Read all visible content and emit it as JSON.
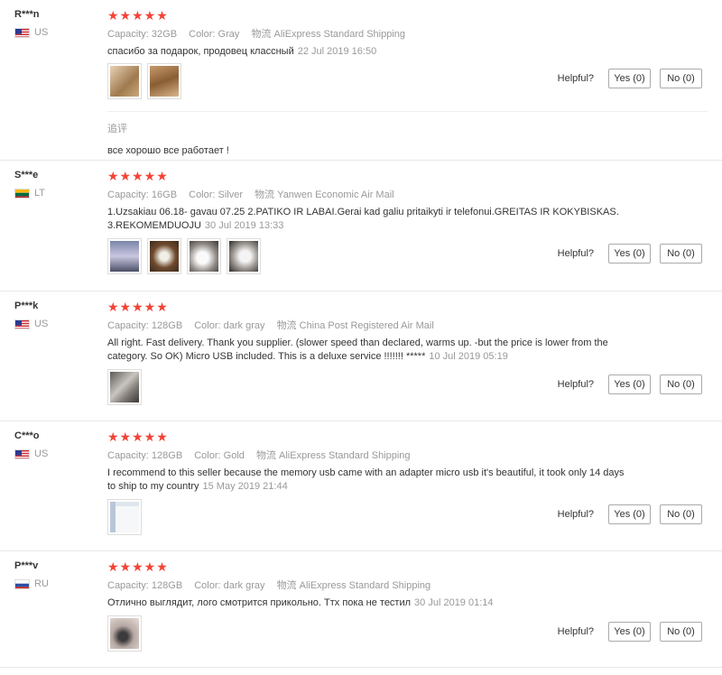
{
  "reviews": [
    {
      "user": "R***n",
      "country": "US",
      "stars": "★★★★★",
      "capacity_label": "Capacity:",
      "capacity": "32GB",
      "color_label": "Color:",
      "color": "Gray",
      "ship_label": "物流",
      "shipping": "AliExpress Standard Shipping",
      "text": "спасибо за подарок, продовец классный",
      "date": "22 Jul 2019 16:50",
      "helpful": "Helpful?",
      "yes": "Yes (0)",
      "no": "No (0)",
      "additional_label": "追评",
      "additional_text": "все хорошо все работает !"
    },
    {
      "user": "S***e",
      "country": "LT",
      "stars": "★★★★★",
      "capacity_label": "Capacity:",
      "capacity": "16GB",
      "color_label": "Color:",
      "color": "Silver",
      "ship_label": "物流",
      "shipping": "Yanwen Economic Air Mail",
      "text_line1": "1.Uzsakiau 06.18- gavau 07.25 2.PATIKO IR LABAI.Gerai kad galiu pritaikyti ir telefonui.GREITAS IR KOKYBISKAS.",
      "text_line2": "3.REKOMEMDUOJU",
      "date": "30 Jul 2019 13:33",
      "helpful": "Helpful?",
      "yes": "Yes (0)",
      "no": "No (0)"
    },
    {
      "user": "P***k",
      "country": "US",
      "stars": "★★★★★",
      "capacity_label": "Capacity:",
      "capacity": "128GB",
      "color_label": "Color:",
      "color": "dark gray",
      "ship_label": "物流",
      "shipping": "China Post Registered Air Mail",
      "text_line1": "All right. Fast delivery. Thank you supplier. (slower speed than declared, warms up. -but the price is lower from the",
      "text_line2": "category. So OK) Micro USB included. This is a deluxe service !!!!!!! *****",
      "date": "10 Jul 2019 05:19",
      "helpful": "Helpful?",
      "yes": "Yes (0)",
      "no": "No (0)"
    },
    {
      "user": "C***o",
      "country": "US",
      "stars": "★★★★★",
      "capacity_label": "Capacity:",
      "capacity": "128GB",
      "color_label": "Color:",
      "color": "Gold",
      "ship_label": "物流",
      "shipping": "AliExpress Standard Shipping",
      "text_line1": "I recommend to this seller because the memory usb came with an adapter micro usb it's beautiful, it took only 14 days",
      "text_line2": "to ship to my country",
      "date": "15 May 2019 21:44",
      "helpful": "Helpful?",
      "yes": "Yes (0)",
      "no": "No (0)"
    },
    {
      "user": "P***v",
      "country": "RU",
      "stars": "★★★★★",
      "capacity_label": "Capacity:",
      "capacity": "128GB",
      "color_label": "Color:",
      "color": "dark gray",
      "ship_label": "物流",
      "shipping": "AliExpress Standard Shipping",
      "text": "Отлично выглядит, лого смотрится прикольно. Ттх пока не тестил",
      "date": "30 Jul 2019 01:14",
      "helpful": "Helpful?",
      "yes": "Yes (0)",
      "no": "No (0)"
    }
  ],
  "colors": {
    "star": "#f44336",
    "muted": "#999999",
    "text": "#333333"
  }
}
